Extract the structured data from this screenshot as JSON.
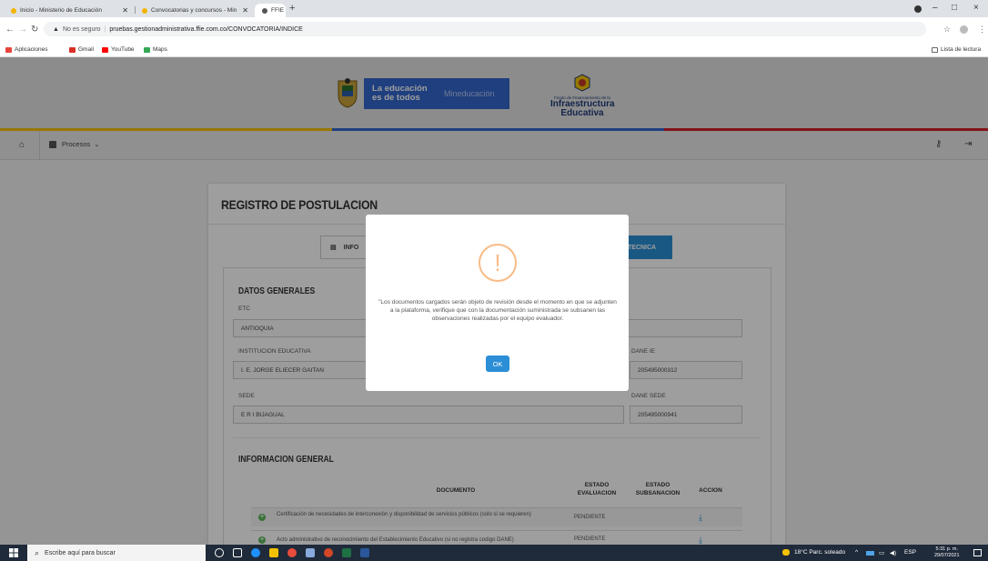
{
  "browser": {
    "tabs": [
      {
        "title": "Inicio - Ministerio de Educación",
        "active": false
      },
      {
        "title": "Convocatorias y concursos - Min",
        "active": false
      },
      {
        "title": "FFIE",
        "active": true
      }
    ],
    "new_tab": "+",
    "window_controls": [
      "–",
      "□",
      "×"
    ],
    "security_label": "No es seguro",
    "url": "pruebas.gestionadministrativa.ffie.com.co/CONVOCATORIA/INDICE",
    "bookmarks": [
      {
        "label": "Aplicaciones",
        "icon": "apps-grid-icon",
        "color": "#e8453c"
      },
      {
        "label": "Gmail",
        "icon": "gmail-icon",
        "color": "#d93025"
      },
      {
        "label": "YouTube",
        "icon": "youtube-icon",
        "color": "#ff0000"
      },
      {
        "label": "Maps",
        "icon": "maps-icon",
        "color": "#34a853"
      }
    ],
    "reading_list": "Lista de lectura"
  },
  "header": {
    "gov_line1": "La educación es de todos",
    "gov_line2": "Mineducación",
    "infra_small": "Fondo de Financiamiento de la",
    "infra_line1": "Infraestructura",
    "infra_line2": "Educativa"
  },
  "nav": {
    "procesos": "Procesos"
  },
  "card": {
    "title": "REGISTRO DE POSTULACION",
    "tab_info": "INFO",
    "tab_tecnica": "TECNICA",
    "datos_generales": "DATOS GENERALES",
    "fields": {
      "etc_label": "ETC",
      "etc_value": "ANTIOQUIA",
      "inst_label": "INSTITUCION EDUCATIVA",
      "inst_value": "I. E. JORGE ELIECER GAITAN",
      "dane_ie_label": "DANE IE",
      "dane_ie_value": "205495000312",
      "sede_label": "SEDE",
      "sede_value": "E R I BIJAGUAL",
      "dane_sede_label": "DANE SEDE",
      "dane_sede_value": "205495000941"
    },
    "info_general": "INFORMACION GENERAL",
    "table": {
      "headers": {
        "documento": "DOCUMENTO",
        "estado_eval_1": "ESTADO",
        "estado_eval_2": "EVALUACION",
        "estado_sub_1": "ESTADO",
        "estado_sub_2": "SUBSANACION",
        "accion": "ACCION"
      },
      "rows": [
        {
          "documento": "Certificación de necesidades de interconexión y disponibilidad de servicios públicos (solo si se requieren)",
          "estado": "PENDIENTE"
        },
        {
          "documento": "Acto administrativo de reconocimiento del Establecimiento Educativo (si no registra codigo DANE)",
          "estado": "PENDIENTE"
        }
      ]
    }
  },
  "modal": {
    "icon": "!",
    "message": "\"Los documentos cargados serán objeto de revisión desde el momento en que se adjunten a la plataforma, verifique que con la documentación suministrada se subsanen las observaciones realizadas por el equipo evaluador.",
    "ok": "OK",
    "accent_color": "#f8bb86",
    "button_color": "#2b8ed6"
  },
  "taskbar": {
    "search_placeholder": "Escribe aquí para buscar",
    "weather": "18°C Parc. soleado",
    "lang": "ESP",
    "time": "5:31 p. m.",
    "date": "29/07/2021"
  }
}
